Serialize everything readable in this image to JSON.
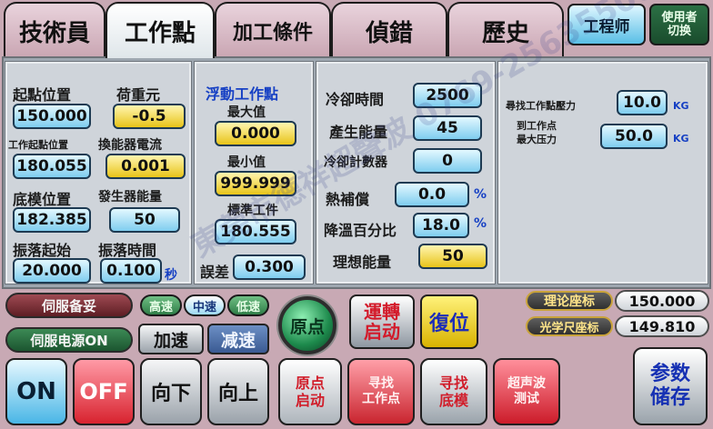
{
  "tabs": {
    "tech": "技術員",
    "workpoint": "工作點",
    "process": "加工條件",
    "error": "偵錯",
    "history": "歷史"
  },
  "header": {
    "engineer": "工程师",
    "user_line1": "使用者",
    "user_line2": "切换"
  },
  "left": {
    "start_pos_label": "起點位置",
    "start_pos_value": "150.000",
    "load_label": "荷重元",
    "load_value": "-0.5",
    "work_start_label": "工作起點位置",
    "work_start_value": "180.055",
    "transducer_label": "換能器電流",
    "transducer_value": "0.001",
    "bottom_die_label": "底模位置",
    "bottom_die_value": "182.385",
    "generator_label": "發生器能量",
    "generator_value": "50",
    "vib_start_label": "振落起始",
    "vib_start_value": "20.000",
    "vib_time_label": "振落時間",
    "vib_time_value": "0.100",
    "sec_unit": "秒"
  },
  "float": {
    "title": "浮動工作點",
    "max_label": "最大值",
    "max_value": "0.000",
    "min_label": "最小值",
    "min_value": "999.999",
    "std_label": "標準工件",
    "std_value": "180.555",
    "err_label": "誤差",
    "err_value": "0.300"
  },
  "cool": {
    "cool_time_label": "冷卻時間",
    "cool_time_value": "2500",
    "energy_label": "產生能量",
    "energy_value": "45",
    "counter_label": "冷卻計數器",
    "counter_value": "0",
    "heat_label": "熱補償",
    "heat_value": "0.0",
    "temp_drop_label": "降溫百分比",
    "temp_drop_value": "18.0",
    "ideal_label": "理想能量",
    "ideal_value": "50",
    "percent": "%"
  },
  "pressure": {
    "find_label": "尋找工作點壓力",
    "find_value": "10.0",
    "max_label1": "到工作点",
    "max_label2": "最大压力",
    "max_value": "50.0",
    "unit": "KG"
  },
  "controls": {
    "servo_ready": "伺服备妥",
    "servo_power": "伺服电源ON",
    "speed_high": "高速",
    "speed_mid": "中速",
    "speed_low": "低速",
    "accel": "加速",
    "decel": "减速",
    "origin": "原点",
    "run_line1": "運轉",
    "run_line2": "启动",
    "reset": "復位",
    "theory_label": "理论座标",
    "theory_value": "150.000",
    "scale_label": "光学尺座标",
    "scale_value": "149.810"
  },
  "bottom": {
    "on": "ON",
    "off": "OFF",
    "down": "向下",
    "up": "向上",
    "origin_start_line1": "原点",
    "origin_start_line2": "启动",
    "find_work_line1": "寻找",
    "find_work_line2": "工作点",
    "find_bottom_line1": "寻找",
    "find_bottom_line2": "底模",
    "ultrasonic_line1": "超声波",
    "ultrasonic_line2": "测试",
    "save_line1": "参数",
    "save_line2": "储存"
  },
  "watermark": "東莞市德祥超聲波 0769-25635500",
  "colors": {
    "background": "#c8a9b4",
    "field_cyan": "#7fcdef",
    "field_yellow": "#e8c419",
    "unit_blue": "#1741c4"
  }
}
